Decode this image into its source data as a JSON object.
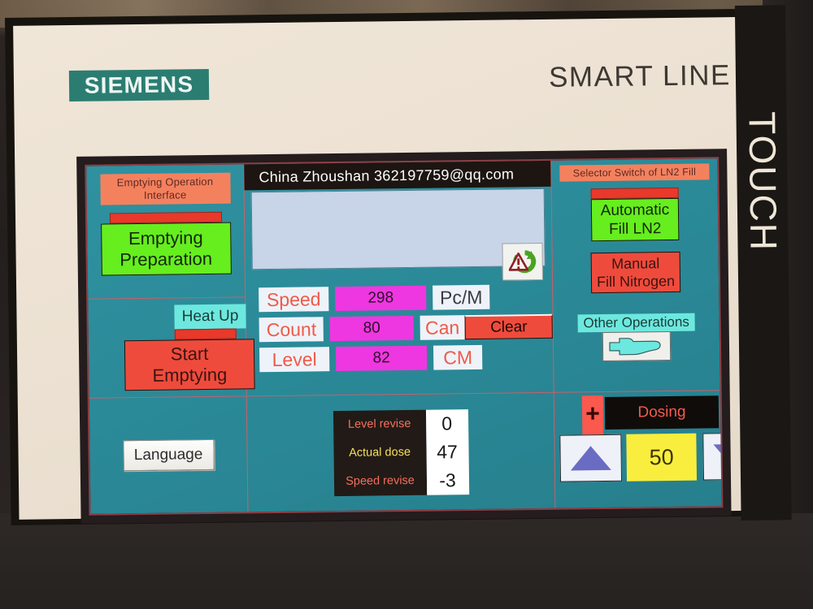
{
  "device": {
    "brand": "SIEMENS",
    "product_line": "SMART LINE",
    "touch_mark": "TOUCH"
  },
  "screen": {
    "header_text": "China  Zhoushan   362197759@qq.com",
    "alarm_icon": "acknowledge-alarm-icon"
  },
  "left_panel": {
    "title": "Emptying Operation Interface",
    "emptying_preparation": "Emptying\nPreparation",
    "emptying_preparation_l1": "Emptying",
    "emptying_preparation_l2": "Preparation",
    "heat_up": "Heat Up",
    "start_emptying_l1": "Start",
    "start_emptying_l2": "Emptying"
  },
  "center_panel": {
    "rows": [
      {
        "name": "Speed",
        "value": "298",
        "unit": "Pc/M"
      },
      {
        "name": "Count",
        "value": "80",
        "unit": "Can"
      },
      {
        "name": "Level",
        "value": "82",
        "unit": "CM"
      }
    ],
    "clear_button": "Clear"
  },
  "right_panel": {
    "title": "Selector Switch of LN2 Fill",
    "automatic_l1": "Automatic",
    "automatic_l2": "Fill LN2",
    "manual_l1": "Manual",
    "manual_l2": "Fill Nitrogen",
    "other_operations": "Other Operations",
    "hand_icon": "pointing-hand-icon"
  },
  "bottom_panel": {
    "language_button": "Language",
    "revise_rows": [
      {
        "label": "Level revise",
        "value": "0"
      },
      {
        "label": "Actual dose",
        "value": "47"
      },
      {
        "label": "Speed revise",
        "value": "-3"
      }
    ],
    "dosing_title": "Dosing",
    "plus": "+",
    "minus": "-",
    "dose_value": "50",
    "up_arrow": "increase-arrow-icon",
    "down_arrow": "decrease-arrow-icon"
  },
  "colors": {
    "screen_teal": "#2a8896",
    "accent_magenta": "#ee37e0",
    "accent_green": "#66ee1f",
    "accent_red": "#ef4b3c",
    "accent_orange": "#f4815e",
    "accent_yellow": "#f9ee3e",
    "accent_cyan": "#6de8de",
    "siemens_teal": "#2b7d72"
  }
}
